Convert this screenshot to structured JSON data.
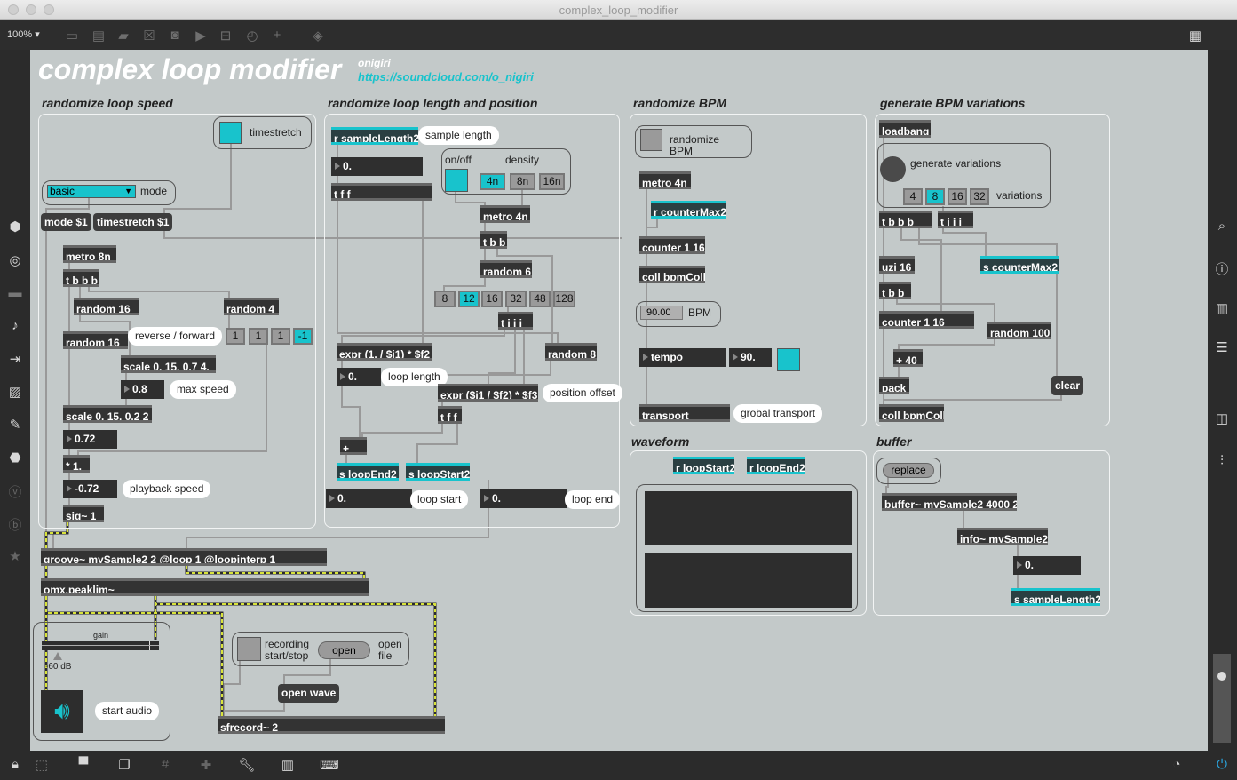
{
  "window": {
    "title": "complex_loop_modifier"
  },
  "toolbar": {
    "zoom": "100%"
  },
  "header": {
    "title": "complex loop modifier",
    "author": "onigiri",
    "url": "https://soundcloud.com/o_nigiri"
  },
  "sections": {
    "speed": "randomize loop speed",
    "length": "randomize loop length and position",
    "bpm": "randomize BPM",
    "gen": "generate BPM variations",
    "waveform": "waveform",
    "buffer": "buffer"
  },
  "speed": {
    "timestretch": "timestretch",
    "menu_value": "basic",
    "mode": "mode",
    "mode_msg": "mode $1",
    "ts_msg": "timestretch $1",
    "metro": "metro 8n",
    "tbbb": "t b b b",
    "rand16a": "random 16",
    "rand4": "random 4",
    "rand16b": "random 16",
    "revfwd": "reverse / forward",
    "dirs": [
      "1",
      "1",
      "1",
      "-1"
    ],
    "scale1": "scale 0. 15. 0.7 4.",
    "maxspeed_val": "0.8",
    "maxspeed": "max speed",
    "scale2": "scale 0. 15. 0.2 2",
    "val1": "0.72",
    "mult": "* 1.",
    "val2": "-0.72",
    "playback": "playback speed",
    "sig": "sig~ 1"
  },
  "length": {
    "recv": "r sampleLength2",
    "sample_length": "sample length",
    "num1": "0.",
    "tff": "t f f",
    "onoff": "on/off",
    "density": "density",
    "dens": [
      "4n",
      "8n",
      "16n"
    ],
    "metro": "metro 4n",
    "tbb": "t b b",
    "rand6": "random 6",
    "divs": [
      "8",
      "12",
      "16",
      "32",
      "48",
      "128"
    ],
    "tiii": "t i i i",
    "expr1": "expr (1. / $i1) * $f2",
    "rand8": "random 8",
    "looplen_val": "0.",
    "looplen": "loop length",
    "expr2": "expr ($i1 / $f2) * $f3",
    "posoff": "position offset",
    "tff2": "t f f",
    "plus": "+",
    "send_end": "s loopEnd2",
    "send_start": "s loopStart2",
    "start_val": "0.",
    "loop_start": "loop start",
    "end_val": "0.",
    "loop_end": "loop end"
  },
  "bpm": {
    "randomize": "randomize BPM",
    "metro": "metro 4n",
    "recv": "r counterMax2",
    "counter": "counter 1 16",
    "coll": "coll bpmColl",
    "bpm_val": "90.00",
    "bpm": "BPM",
    "tempo": "tempo",
    "tempo_val": "90.",
    "transport": "transport",
    "transport_label": "grobal transport"
  },
  "gen": {
    "loadbang": "loadbang",
    "generate": "generate variations",
    "vars": [
      "4",
      "8",
      "16",
      "32"
    ],
    "variations": "variations",
    "tbbb": "t b b b",
    "tiii": "t i i i",
    "uzi": "uzi 16",
    "send": "s counterMax2",
    "tbb": "t b b",
    "counter": "counter 1 16",
    "rand": "random 100",
    "plus": "+ 40",
    "pack": "pack",
    "clear": "clear",
    "coll": "coll bpmColl"
  },
  "waveform": {
    "r_start": "r loopStart2",
    "r_end": "r loopEnd2"
  },
  "buffer": {
    "replace": "replace",
    "buf": "buffer~ mySample2 4000 2",
    "info": "info~ mySample2",
    "num": "0.",
    "send": "s sampleLength2"
  },
  "audio": {
    "groove": "groove~ mySample2 2 @loop 1 @loopinterp 1",
    "limiter": "omx.peaklim~",
    "gain": "gain",
    "gain_db": "-60 dB",
    "start_audio": "start audio",
    "recording": "recording start/stop",
    "open": "open",
    "open_file": "open file",
    "open_wave": "open wave",
    "sfrecord": "sfrecord~ 2"
  },
  "colors": {
    "accent": "#18c3cc",
    "canvas": "#c3c9c9",
    "object": "#333333"
  }
}
